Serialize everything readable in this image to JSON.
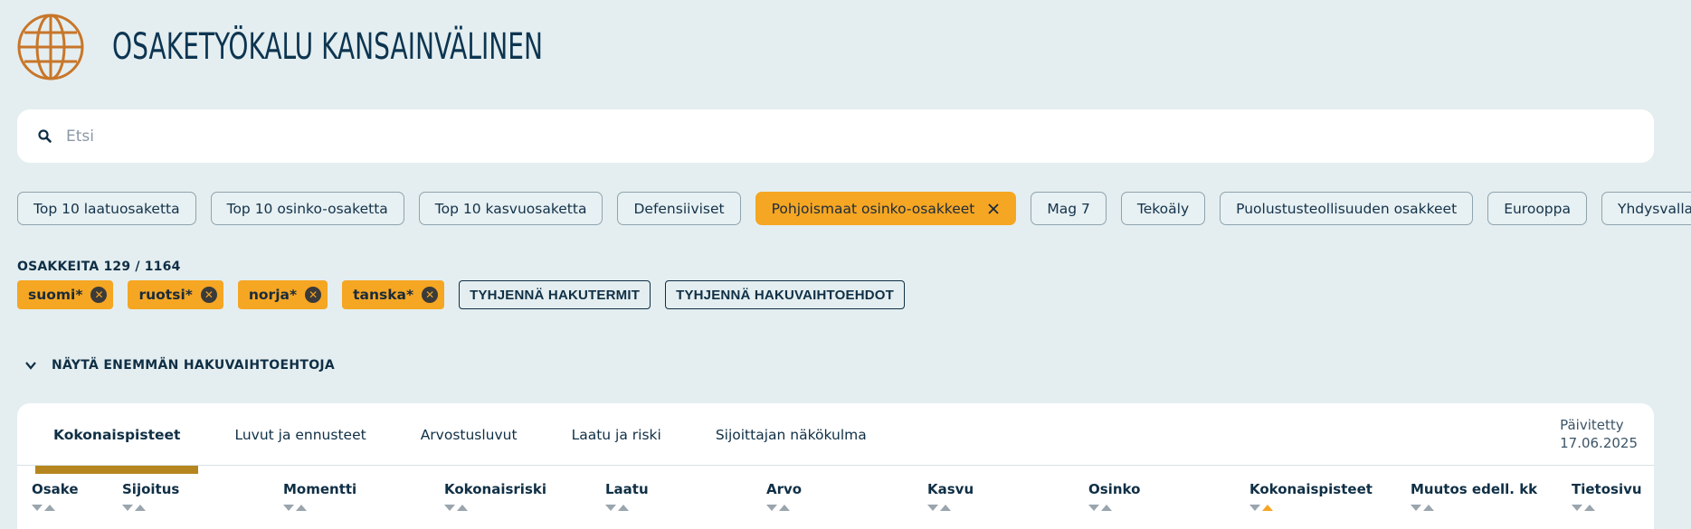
{
  "header": {
    "title": "OSAKETYÖKALU KANSAINVÄLINEN",
    "logo_icon": "globe-icon",
    "accent": "#c8762a"
  },
  "search": {
    "placeholder": "Etsi",
    "value": ""
  },
  "presets": [
    {
      "label": "Top 10 laatuosaketta",
      "active": false
    },
    {
      "label": "Top 10 osinko-osaketta",
      "active": false
    },
    {
      "label": "Top 10 kasvuosaketta",
      "active": false
    },
    {
      "label": "Defensiiviset",
      "active": false
    },
    {
      "label": "Pohjoismaat osinko-osakkeet",
      "active": true
    },
    {
      "label": "Mag 7",
      "active": false
    },
    {
      "label": "Tekoäly",
      "active": false
    },
    {
      "label": "Puolustusteollisuuden osakkeet",
      "active": false
    },
    {
      "label": "Eurooppa",
      "active": false
    },
    {
      "label": "Yhdysvallat",
      "active": false
    }
  ],
  "count_label": "OSAKKEITA 129 / 1164",
  "filters": {
    "tags": [
      "suomi*",
      "ruotsi*",
      "norja*",
      "tanska*"
    ],
    "clear_terms": "TYHJENNÄ HAKUTERMIT",
    "clear_options": "TYHJENNÄ HAKUVAIHTOEHDOT"
  },
  "more_options": "NÄYTÄ ENEMMÄN HAKUVAIHTOEHTOJA",
  "panel": {
    "tabs": [
      "Kokonaispisteet",
      "Luvut ja ennusteet",
      "Arvostusluvut",
      "Laatu ja riski",
      "Sijoittajan näkökulma"
    ],
    "active_tab": 0,
    "updated_label": "Päivitetty",
    "updated_date": "17.06.2025",
    "columns": [
      "Osake",
      "Sijoitus",
      "Momentti",
      "Kokonaisriski",
      "Laatu",
      "Arvo",
      "Kasvu",
      "Osinko",
      "Kokonaispisteet",
      "Muutos edell. kk",
      "Tietosivu"
    ],
    "sorted_column": "Kokonaispisteet",
    "active_color": "#f5a623",
    "tab_underline_color": "#b5861f"
  }
}
